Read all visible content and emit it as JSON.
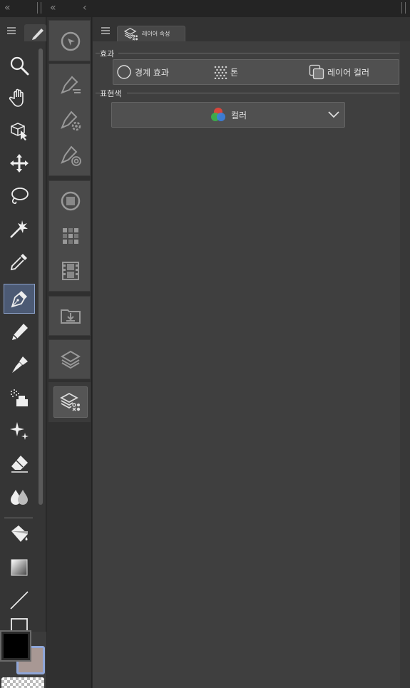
{
  "topbar": {
    "collapse_left": "«",
    "collapse_mid": "«",
    "collapse_back": "‹"
  },
  "tools": [
    {
      "name": "zoom",
      "icon": "magnifier-icon"
    },
    {
      "name": "move",
      "icon": "hand-icon"
    },
    {
      "name": "object",
      "icon": "object-cube-icon"
    },
    {
      "name": "move-layer",
      "icon": "move-arrows-icon"
    },
    {
      "name": "lasso",
      "icon": "lasso-icon"
    },
    {
      "name": "auto-select",
      "icon": "magic-wand-icon"
    },
    {
      "name": "eyedropper",
      "icon": "eyedropper-icon"
    },
    {
      "name": "pen",
      "icon": "pen-nib-icon",
      "selected": true
    },
    {
      "name": "pencil",
      "icon": "pencil-icon"
    },
    {
      "name": "brush",
      "icon": "brush-icon"
    },
    {
      "name": "airbrush",
      "icon": "airbrush-icon"
    },
    {
      "name": "decoration",
      "icon": "sparkle-icon"
    },
    {
      "name": "eraser",
      "icon": "eraser-icon"
    },
    {
      "name": "blend",
      "icon": "blend-drops-icon"
    },
    {
      "name": "fill",
      "icon": "paint-bucket-icon"
    },
    {
      "name": "gradient",
      "icon": "gradient-icon"
    },
    {
      "name": "figure",
      "icon": "line-icon"
    }
  ],
  "colors": {
    "foreground": "#000000",
    "background": "#a89894"
  },
  "panel": {
    "tab_label": "레이어 속성",
    "effects_section": "효과",
    "effects": {
      "border": "경계 효과",
      "tone": "톤",
      "layer_color": "레이어 컬러"
    },
    "expression_section": "표현색",
    "expression_value": "컬러"
  }
}
